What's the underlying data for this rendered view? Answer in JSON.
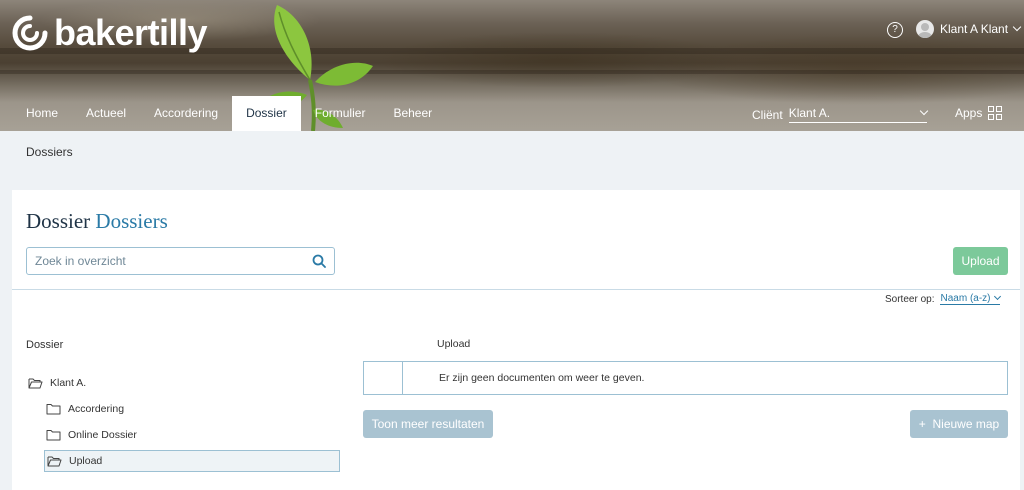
{
  "brand": {
    "logo_text": "bakertilly"
  },
  "header": {
    "user_name": "Klant A Klant",
    "client_label": "Cliënt",
    "client_value": "Klant A.",
    "apps_label": "Apps"
  },
  "nav": {
    "items": [
      {
        "label": "Home"
      },
      {
        "label": "Actueel"
      },
      {
        "label": "Accordering"
      },
      {
        "label": "Dossier",
        "active": true
      },
      {
        "label": "Formulier"
      },
      {
        "label": "Beheer"
      }
    ]
  },
  "breadcrumb": {
    "label": "Dossiers"
  },
  "page": {
    "title_main": "Dossier",
    "title_accent": "Dossiers",
    "search_placeholder": "Zoek in overzicht",
    "upload_button": "Upload",
    "sort_label": "Sorteer op:",
    "sort_value": "Naam (a-z)"
  },
  "tree": {
    "title": "Dossier",
    "root": "Klant A.",
    "children": [
      {
        "label": "Accordering",
        "selected": false
      },
      {
        "label": "Online Dossier",
        "selected": false
      },
      {
        "label": "Upload",
        "selected": true
      }
    ]
  },
  "documents": {
    "header": "Upload",
    "empty_message": "Er zijn geen documenten om weer te geven."
  },
  "buttons": {
    "show_more": "Toon meer resultaten",
    "new_folder": "Nieuwe map",
    "new_folder_prefix": "+"
  },
  "colors": {
    "accent": "#2a7aa6",
    "primary_dark": "#1f3346",
    "upload_green": "#7cc99a",
    "disabled_button": "#a9c3d1"
  }
}
